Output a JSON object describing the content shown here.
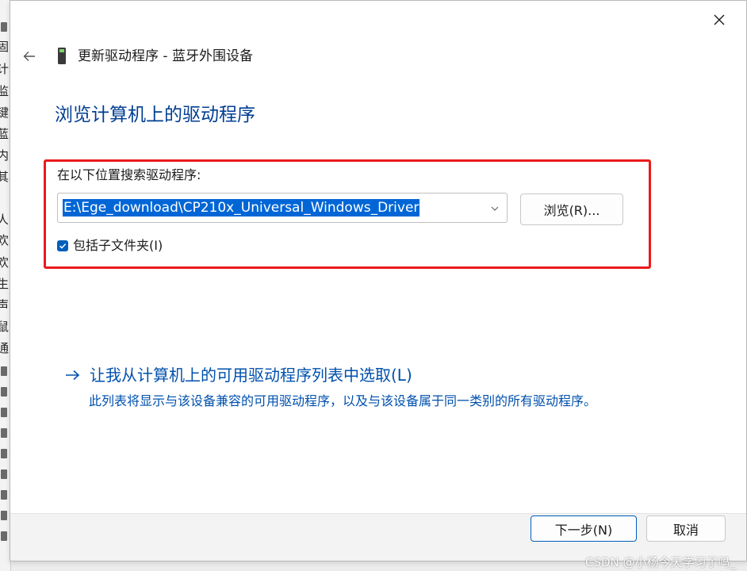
{
  "background_window": {
    "glyphs": [
      "固",
      "计",
      "监",
      "键",
      "蓝",
      "内",
      "其",
      "人",
      "欢",
      "欢",
      "生",
      "声",
      "鼠",
      "通"
    ]
  },
  "dialog": {
    "title": "更新驱动程序 - 蓝牙外围设备",
    "heading": "浏览计算机上的驱动程序",
    "search": {
      "label": "在以下位置搜索驱动程序:",
      "path_value": "E:\\Ege_download\\CP210x_Universal_Windows_Driver",
      "browse_label": "浏览(R)...",
      "include_subfolders_label": "包括子文件夹(I)",
      "include_subfolders_checked": true
    },
    "pick_link": {
      "title": "让我从计算机上的可用驱动程序列表中选取(L)",
      "description": "此列表将显示与该设备兼容的可用驱动程序，以及与该设备属于同一类别的所有驱动程序。"
    },
    "footer": {
      "next_label": "下一步(N)",
      "cancel_label": "取消"
    }
  },
  "watermark": "CSDN @小杨今天学习了吗_",
  "colors": {
    "heading": "#003e92",
    "link": "#0050ad",
    "highlight": "#ea1a1a",
    "selection": "#0066d6",
    "accent": "#005fb8"
  },
  "icons": {
    "close": "close-icon",
    "back": "back-arrow-icon",
    "device": "bluetooth-device-icon",
    "dropdown": "chevron-down-icon",
    "checkbox": "checkmark-icon",
    "link_arrow": "right-arrow-icon"
  }
}
